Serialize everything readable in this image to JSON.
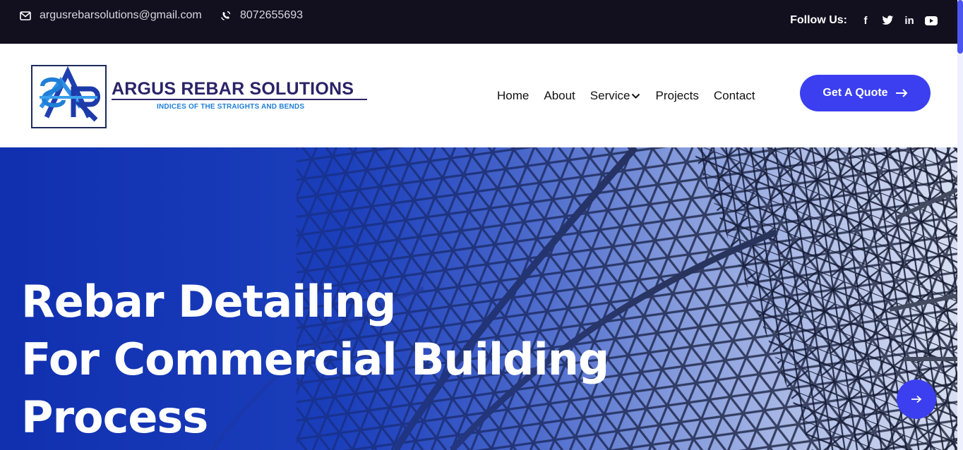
{
  "topbar": {
    "email": "argusrebarsolutions@gmail.com",
    "phone": "8072655693",
    "follow_label": "Follow Us:",
    "socials": [
      {
        "icon": "facebook-icon",
        "glyph": "f"
      },
      {
        "icon": "twitter-icon",
        "glyph": ""
      },
      {
        "icon": "linkedin-icon",
        "glyph": "in"
      },
      {
        "icon": "youtube-icon",
        "glyph": ""
      }
    ]
  },
  "logo": {
    "title": "ARGUS REBAR SOLUTIONS",
    "tagline": "INDICES OF THE STRAIGHTS AND BENDS"
  },
  "nav": {
    "items": [
      "Home",
      "About",
      "Service",
      "Projects",
      "Contact"
    ]
  },
  "cta": {
    "label": "Get A Quote"
  },
  "hero": {
    "title_lines": [
      "Rebar Detailing",
      "For Commercial Building",
      "Process"
    ]
  },
  "colors": {
    "topbar_bg": "#120f1f",
    "accent": "#3b3ff0",
    "hero_blue": "#1b3fb8",
    "logo_navy": "#2b2368",
    "logo_blue": "#1f7fd6"
  }
}
